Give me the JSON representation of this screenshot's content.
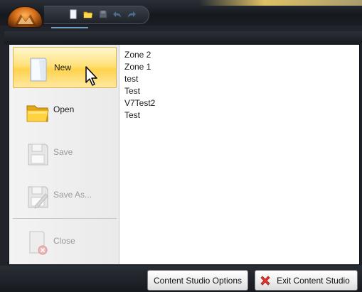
{
  "menu": {
    "items": [
      {
        "label": "New",
        "icon": "new-document-icon",
        "state": "hover"
      },
      {
        "label": "Open",
        "icon": "folder-open-icon",
        "state": "enabled"
      },
      {
        "label": "Save",
        "icon": "save-disk-icon",
        "state": "disabled"
      },
      {
        "label": "Save As...",
        "icon": "save-as-disk-icon",
        "state": "disabled"
      },
      {
        "label": "Close",
        "icon": "close-document-icon",
        "state": "disabled"
      }
    ]
  },
  "recent_documents": [
    "Zone 2",
    "Zone 1",
    "test",
    "Test",
    "V7Test2",
    "Test"
  ],
  "footer": {
    "options_label": "Content Studio Options",
    "exit_label": "Exit Content Studio"
  },
  "quick_access": [
    "new-icon",
    "open-icon",
    "save-icon",
    "undo-icon",
    "redo-icon"
  ],
  "colors": {
    "hover_highlight": "#ffd24c",
    "window_dark": "#20242a",
    "app_button": "#d9731c"
  }
}
